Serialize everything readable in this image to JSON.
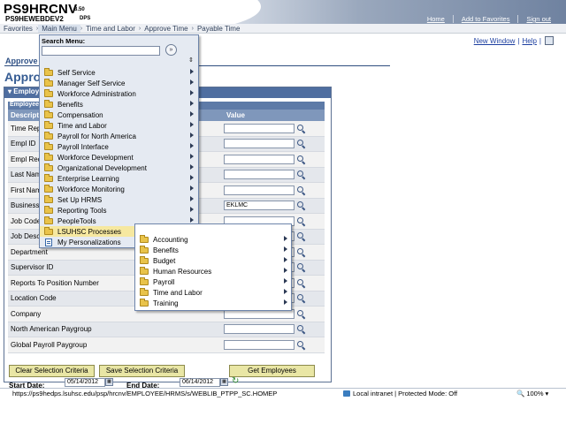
{
  "header": {
    "system_title": "PS9HRCNV",
    "version": "8.50",
    "database": "PS9HEWEBDEV2",
    "server": "DPS",
    "links": [
      "Home",
      "Add to Favorites",
      "Sign out"
    ]
  },
  "breadcrumbs": [
    "Favorites",
    "Main Menu",
    "Time and Labor",
    "Approve Time",
    "Payable Time"
  ],
  "page": {
    "new_window": "New Window",
    "help": "Help",
    "subtitle": "Approve",
    "title": "Approv",
    "panel_header": "Employ",
    "grid_caption": "Employee",
    "col_description": "Descriptio",
    "col_value": "Value",
    "rows": [
      {
        "label": "Time Rep",
        "value": ""
      },
      {
        "label": "Empl ID",
        "value": ""
      },
      {
        "label": "Empl Rec",
        "value": ""
      },
      {
        "label": "Last Nam",
        "value": ""
      },
      {
        "label": "First Nam",
        "value": ""
      },
      {
        "label": "Business",
        "value": "EKLMC"
      },
      {
        "label": "Job Code",
        "value": ""
      },
      {
        "label": "Job Desc",
        "value": ""
      },
      {
        "label": "Department",
        "value": ""
      },
      {
        "label": "Supervisor ID",
        "value": ""
      },
      {
        "label": "Reports To Position Number",
        "value": ""
      },
      {
        "label": "Location Code",
        "value": ""
      },
      {
        "label": "Company",
        "value": ""
      },
      {
        "label": "North American Paygroup",
        "value": ""
      },
      {
        "label": "Global Payroll Paygroup",
        "value": ""
      }
    ],
    "buttons": {
      "clear": "Clear Selection Criteria",
      "save": "Save Selection Criteria",
      "get": "Get Employees"
    },
    "start_date_label": "Start Date:",
    "start_date": "05/14/2012",
    "end_date_label": "End Date:",
    "end_date": "06/14/2012"
  },
  "menu": {
    "search_label": "Search Menu:",
    "search_value": "",
    "go_glyph": "»",
    "sort_glyph": "⇕",
    "items": [
      {
        "label": "Self Service",
        "submenu": true
      },
      {
        "label": "Manager Self Service",
        "submenu": true
      },
      {
        "label": "Workforce Administration",
        "submenu": true
      },
      {
        "label": "Benefits",
        "submenu": true
      },
      {
        "label": "Compensation",
        "submenu": true
      },
      {
        "label": "Time and Labor",
        "submenu": true
      },
      {
        "label": "Payroll for North America",
        "submenu": true
      },
      {
        "label": "Payroll Interface",
        "submenu": true
      },
      {
        "label": "Workforce Development",
        "submenu": true
      },
      {
        "label": "Organizational Development",
        "submenu": true
      },
      {
        "label": "Enterprise Learning",
        "submenu": true
      },
      {
        "label": "Workforce Monitoring",
        "submenu": true
      },
      {
        "label": "Set Up HRMS",
        "submenu": true
      },
      {
        "label": "Reporting Tools",
        "submenu": true
      },
      {
        "label": "PeopleTools",
        "submenu": true
      },
      {
        "label": "LSUHSC Processes",
        "submenu": true
      },
      {
        "label": "My Personalizations",
        "submenu": false
      }
    ],
    "selected_index": 15
  },
  "submenu": {
    "items": [
      "Accounting",
      "Benefits",
      "Budget",
      "Human Resources",
      "Payroll",
      "Time and Labor",
      "Training"
    ]
  },
  "status": {
    "url": "https://ps9hedps.lsuhsc.edu/psp/hrcnv/EMPLOYEE/HRMS/s/WEBLIB_PTPP_SC.HOMEP",
    "zone": "Local intranet | Protected Mode: Off",
    "zoom": "100%"
  },
  "colors": {
    "menu_bg": "#e5eaf2",
    "menu_selected": "#f6e8a0",
    "panel_header": "#4f6ea0",
    "button_bg": "#e9e6a5"
  }
}
